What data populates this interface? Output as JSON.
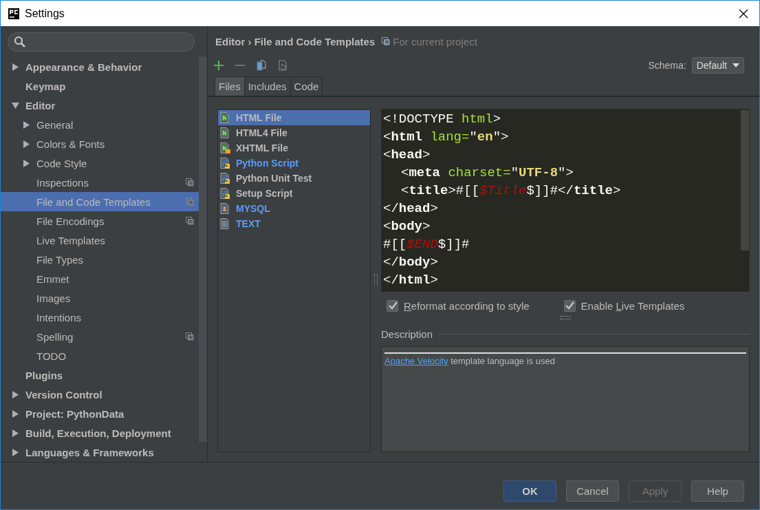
{
  "window": {
    "title": "Settings"
  },
  "sidebar": {
    "items": [
      {
        "label": "Appearance & Behavior",
        "expanded": false,
        "selected": false
      },
      {
        "label": "Keymap",
        "selected": false
      },
      {
        "label": "Editor",
        "expanded": true,
        "selected": false,
        "children": [
          {
            "label": "General",
            "expanded": false,
            "selected": false
          },
          {
            "label": "Colors & Fonts",
            "expanded": false,
            "selected": false
          },
          {
            "label": "Code Style",
            "expanded": false,
            "selected": false
          },
          {
            "label": "Inspections",
            "project_scoped": true,
            "selected": false
          },
          {
            "label": "File and Code Templates",
            "project_scoped": true,
            "selected": true
          },
          {
            "label": "File Encodings",
            "project_scoped": true,
            "selected": false
          },
          {
            "label": "Live Templates",
            "selected": false
          },
          {
            "label": "File Types",
            "selected": false
          },
          {
            "label": "Emmet",
            "selected": false
          },
          {
            "label": "Images",
            "selected": false
          },
          {
            "label": "Intentions",
            "selected": false
          },
          {
            "label": "Spelling",
            "project_scoped": true,
            "selected": false
          },
          {
            "label": "TODO",
            "selected": false
          }
        ]
      },
      {
        "label": "Plugins",
        "selected": false
      },
      {
        "label": "Version Control",
        "expanded": false,
        "selected": false
      },
      {
        "label": "Project: PythonData",
        "expanded": false,
        "selected": false
      },
      {
        "label": "Build, Execution, Deployment",
        "expanded": false,
        "selected": false
      },
      {
        "label": "Languages & Frameworks",
        "expanded": false,
        "selected": false
      }
    ]
  },
  "header": {
    "breadcrumb": "Editor › File and Code Templates",
    "scope": "For current project"
  },
  "toolbar": [
    {
      "kind": "add",
      "disabled": false
    },
    {
      "kind": "remove",
      "disabled": true
    },
    {
      "kind": "copy",
      "disabled": false
    },
    {
      "kind": "reset",
      "disabled": true
    }
  ],
  "schema": {
    "label": "Schema:",
    "value": "Default"
  },
  "tabs": [
    {
      "label": "Files",
      "selected": true
    },
    {
      "label": "Includes",
      "selected": false
    },
    {
      "label": "Code",
      "selected": false
    }
  ],
  "templates": [
    {
      "name": "HTML File",
      "kind": "html",
      "customized": false,
      "selected": true
    },
    {
      "name": "HTML4 File",
      "kind": "html",
      "customized": false,
      "selected": false
    },
    {
      "name": "XHTML File",
      "kind": "xhtml",
      "customized": false,
      "selected": false
    },
    {
      "name": "Python Script",
      "kind": "python",
      "customized": true,
      "selected": false
    },
    {
      "name": "Python Unit Test",
      "kind": "python",
      "customized": false,
      "selected": false
    },
    {
      "name": "Setup Script",
      "kind": "python",
      "customized": false,
      "selected": false
    },
    {
      "name": "MYSQL",
      "kind": "sql",
      "customized": true,
      "selected": false
    },
    {
      "name": "TEXT",
      "kind": "text",
      "customized": true,
      "selected": false
    }
  ],
  "code": [
    {
      "indented": false,
      "tokens": [
        {
          "text": "<!DOCTYPE ",
          "kind": "punct"
        },
        {
          "text": "html",
          "kind": "attr"
        },
        {
          "text": ">",
          "kind": "punct"
        }
      ]
    },
    {
      "indented": false,
      "tokens": [
        {
          "text": "<",
          "kind": "punct"
        },
        {
          "text": "html",
          "kind": "tag"
        },
        {
          "text": " lang=",
          "kind": "attr"
        },
        {
          "text": "\"",
          "kind": "punct"
        },
        {
          "text": "en",
          "kind": "string"
        },
        {
          "text": "\">",
          "kind": "punct"
        }
      ]
    },
    {
      "indented": false,
      "tokens": [
        {
          "text": "<",
          "kind": "punct"
        },
        {
          "text": "head",
          "kind": "tag"
        },
        {
          "text": ">",
          "kind": "punct"
        }
      ]
    },
    {
      "indented": true,
      "tokens": [
        {
          "text": "<",
          "kind": "punct"
        },
        {
          "text": "meta",
          "kind": "tag"
        },
        {
          "text": " charset=",
          "kind": "attr"
        },
        {
          "text": "\"",
          "kind": "punct"
        },
        {
          "text": "UTF-8",
          "kind": "string"
        },
        {
          "text": "\">",
          "kind": "punct"
        }
      ]
    },
    {
      "indented": true,
      "tokens": [
        {
          "text": "<",
          "kind": "punct"
        },
        {
          "text": "title",
          "kind": "tag"
        },
        {
          "text": ">#[[",
          "kind": "punct"
        },
        {
          "text": "$Title",
          "kind": "var"
        },
        {
          "text": "$]]#</",
          "kind": "punct"
        },
        {
          "text": "title",
          "kind": "tag"
        },
        {
          "text": ">",
          "kind": "punct"
        }
      ]
    },
    {
      "indented": false,
      "tokens": [
        {
          "text": "</",
          "kind": "punct"
        },
        {
          "text": "head",
          "kind": "tag"
        },
        {
          "text": ">",
          "kind": "punct"
        }
      ]
    },
    {
      "indented": false,
      "tokens": [
        {
          "text": "<",
          "kind": "punct"
        },
        {
          "text": "body",
          "kind": "tag"
        },
        {
          "text": ">",
          "kind": "punct"
        }
      ]
    },
    {
      "indented": false,
      "tokens": [
        {
          "text": "#[[",
          "kind": "punct"
        },
        {
          "text": "$END",
          "kind": "var"
        },
        {
          "text": "$]]#",
          "kind": "punct"
        }
      ]
    },
    {
      "indented": false,
      "tokens": [
        {
          "text": "</",
          "kind": "punct"
        },
        {
          "text": "body",
          "kind": "tag"
        },
        {
          "text": ">",
          "kind": "punct"
        }
      ]
    },
    {
      "indented": false,
      "tokens": [
        {
          "text": "</",
          "kind": "punct"
        },
        {
          "text": "html",
          "kind": "tag"
        },
        {
          "text": ">",
          "kind": "punct"
        }
      ]
    }
  ],
  "options": [
    {
      "parts": [
        {
          "text": "R",
          "underlined": true
        },
        {
          "text": "eformat according to style",
          "underlined": false
        }
      ],
      "checked": true
    },
    {
      "parts": [
        {
          "text": "Enable ",
          "underlined": false
        },
        {
          "text": "L",
          "underlined": true
        },
        {
          "text": "ive Templates",
          "underlined": false
        }
      ],
      "checked": true
    }
  ],
  "description": {
    "title": "Description",
    "link": "Apache Velocity",
    "text": " template language is used"
  },
  "buttons": [
    {
      "label": "OK",
      "default": true,
      "disabled": false
    },
    {
      "label": "Cancel",
      "default": false,
      "disabled": false
    },
    {
      "label": "Apply",
      "default": false,
      "disabled": true
    },
    {
      "label": "Help",
      "default": false,
      "disabled": false
    }
  ]
}
